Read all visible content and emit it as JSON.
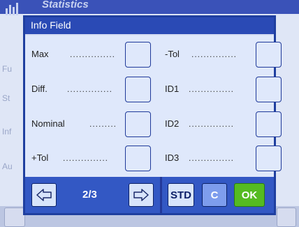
{
  "background": {
    "title": "Statistics",
    "side_items": [
      "Fu",
      "St",
      "Inf",
      "Au"
    ]
  },
  "dialog": {
    "title": "Info Field",
    "fields_left": [
      {
        "label": "Max",
        "dots": "..............."
      },
      {
        "label": "Diff.",
        "dots": "..............."
      },
      {
        "label": "Nominal",
        "dots": "........."
      },
      {
        "label": "+Tol",
        "dots": "..............."
      }
    ],
    "fields_right": [
      {
        "label": "-Tol",
        "dots": "..............."
      },
      {
        "label": "ID1",
        "dots": "..............."
      },
      {
        "label": "ID2",
        "dots": "..............."
      },
      {
        "label": "ID3",
        "dots": "..............."
      }
    ],
    "page_indicator": "2/3",
    "std_label": "STD",
    "c_label": "C",
    "ok_label": "OK",
    "colors": {
      "ok_button": "#55bb22",
      "title_bar": "#2a4ab5",
      "footer": "#3358c4"
    }
  }
}
